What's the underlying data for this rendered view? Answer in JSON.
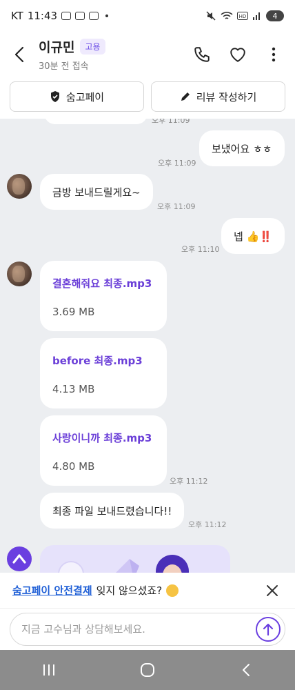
{
  "status_bar": {
    "carrier": "KT",
    "time": "11:43",
    "battery": "4"
  },
  "header": {
    "name": "이규민",
    "badge": "고용",
    "last_seen": "30분 전 접속"
  },
  "actions": {
    "pay": "숨고페이",
    "review": "리뷰 작성하기"
  },
  "messages": {
    "m1": {
      "text": "보냈어요 ㅎㅎ",
      "time": "오후 11:09"
    },
    "m2": {
      "text": "금방 보내드릴게요~",
      "time": "오후 11:09"
    },
    "m3": {
      "text": "넵 👍‼️",
      "time": "오후 11:10"
    },
    "files": [
      {
        "name": "결혼해줘요 최종.mp3",
        "size": "3.69 MB"
      },
      {
        "name": "before 최종.mp3",
        "size": "4.13 MB"
      },
      {
        "name": "사랑이니까 최종.mp3",
        "size": "4.80 MB"
      }
    ],
    "files_time": "오후 11:12",
    "m4": {
      "text": "최종 파일 보내드렸습니다!!",
      "time": "오후 11:12"
    },
    "partial_time": "오후 11:09"
  },
  "notice": {
    "link": "숨고페이 안전결제",
    "text": "잊지 않으셨죠?"
  },
  "input": {
    "placeholder": "지금 고수님과 상담해보세요."
  },
  "colors": {
    "accent": "#6a3fe0",
    "link": "#1f5fd6",
    "chat_bg": "#eceef1"
  }
}
